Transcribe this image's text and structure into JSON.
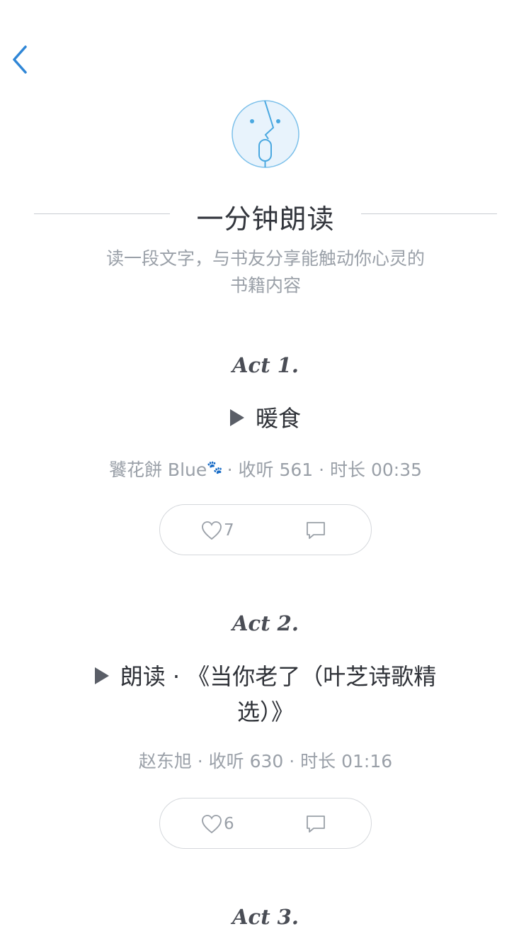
{
  "nav": {
    "back_icon": "chevron-left-icon",
    "accent": "#2f86d6"
  },
  "header": {
    "logo_icon": "face-microphone-icon",
    "title": "一分钟朗读",
    "intro": "读一段文字，与书友分享能触动你心灵的书籍内容"
  },
  "acts": [
    {
      "label": "Act 1.",
      "title": "暖食",
      "author": "饕花餅 Blue",
      "author_badge": "🐾",
      "listen": "· 收听 561",
      "duration": "· 时长 00:35",
      "likes": "7"
    },
    {
      "label": "Act 2.",
      "title": "朗读 · 《当你老了（叶芝诗歌精选）》",
      "meta": "赵东旭 · 收听 630 · 时长 01:16",
      "likes": "6"
    },
    {
      "label": "Act 3."
    }
  ],
  "colors": {
    "text": "#33363d",
    "muted": "#9aa0a8",
    "line": "#c9cdd3",
    "logo_bg": "#e8f3fc",
    "logo_stroke": "#4aa8e0"
  }
}
